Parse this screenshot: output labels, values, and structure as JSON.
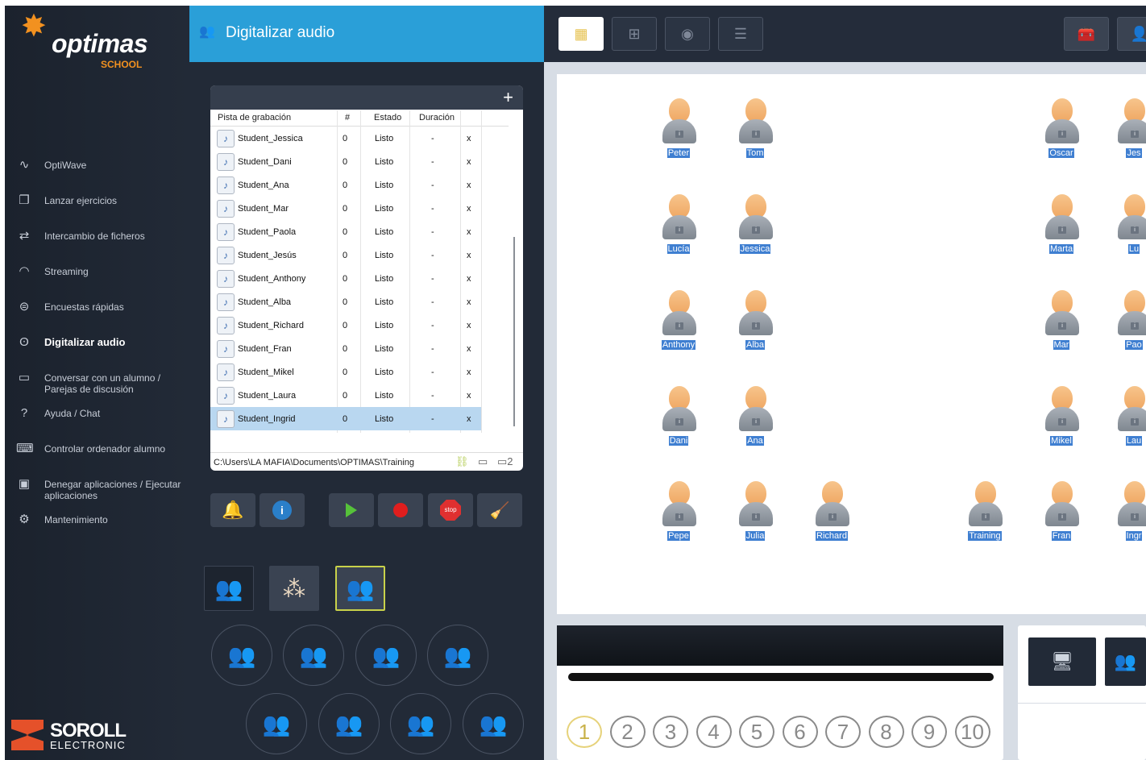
{
  "app": {
    "brand": "optimas",
    "brand_sub": "SCHOOL",
    "vendor": "SOROLL",
    "vendor_sub": "ELECTRONIC"
  },
  "menu": [
    {
      "label": "OptiWave",
      "icon": "waveform-icon"
    },
    {
      "label": "Lanzar ejercicios",
      "icon": "copy-icon"
    },
    {
      "label": "Intercambio de ficheros",
      "icon": "exchange-icon"
    },
    {
      "label": "Streaming",
      "icon": "wifi-icon"
    },
    {
      "label": "Encuestas rápidas",
      "icon": "survey-icon"
    },
    {
      "label": "Digitalizar audio",
      "icon": "people-audio-icon"
    },
    {
      "label": "Conversar con un alumno / Parejas de discusión",
      "icon": "chat-bubble-icon"
    },
    {
      "label": "Ayuda / Chat",
      "icon": "help-icon"
    },
    {
      "label": "Controlar ordenador alumno",
      "icon": "remote-control-icon"
    },
    {
      "label": "Denegar aplicaciones / Ejecutar aplicaciones",
      "icon": "apps-icon"
    },
    {
      "label": "Mantenimiento",
      "icon": "maintenance-icon"
    }
  ],
  "panel": {
    "title": "Digitalizar audio",
    "table": {
      "headers": [
        "Pista de grabación",
        "#",
        "Estado",
        "Duración"
      ],
      "rows": [
        {
          "name": "Student_Jessica",
          "count": "0",
          "status": "Listo",
          "duration": "-",
          "remove": "x"
        },
        {
          "name": "Student_Dani",
          "count": "0",
          "status": "Listo",
          "duration": "-",
          "remove": "x"
        },
        {
          "name": "Student_Ana",
          "count": "0",
          "status": "Listo",
          "duration": "-",
          "remove": "x"
        },
        {
          "name": "Student_Mar",
          "count": "0",
          "status": "Listo",
          "duration": "-",
          "remove": "x"
        },
        {
          "name": "Student_Paola",
          "count": "0",
          "status": "Listo",
          "duration": "-",
          "remove": "x"
        },
        {
          "name": "Student_Jesús",
          "count": "0",
          "status": "Listo",
          "duration": "-",
          "remove": "x"
        },
        {
          "name": "Student_Anthony",
          "count": "0",
          "status": "Listo",
          "duration": "-",
          "remove": "x"
        },
        {
          "name": "Student_Alba",
          "count": "0",
          "status": "Listo",
          "duration": "-",
          "remove": "x"
        },
        {
          "name": "Student_Richard",
          "count": "0",
          "status": "Listo",
          "duration": "-",
          "remove": "x"
        },
        {
          "name": "Student_Fran",
          "count": "0",
          "status": "Listo",
          "duration": "-",
          "remove": "x"
        },
        {
          "name": "Student_Mikel",
          "count": "0",
          "status": "Listo",
          "duration": "-",
          "remove": "x"
        },
        {
          "name": "Student_Laura",
          "count": "0",
          "status": "Listo",
          "duration": "-",
          "remove": "x"
        },
        {
          "name": "Student_Ingrid",
          "count": "0",
          "status": "Listo",
          "duration": "-",
          "remove": "x",
          "selected": true
        }
      ],
      "path": "C:\\Users\\LA MAFIA\\Documents\\OPTIMAS\\Training"
    },
    "controls": [
      {
        "name": "bell-button",
        "icon": "bell-icon"
      },
      {
        "name": "info-button",
        "icon": "info-icon"
      },
      {
        "name": "play-button",
        "icon": "play-icon"
      },
      {
        "name": "record-button",
        "icon": "record-icon"
      },
      {
        "name": "stop-button",
        "icon": "stop-icon",
        "label": "stop"
      },
      {
        "name": "clear-button",
        "icon": "broom-icon"
      }
    ]
  },
  "classroom": {
    "students": [
      {
        "name": "Peter"
      },
      {
        "name": "Tom"
      },
      {
        "name": "Oscar"
      },
      {
        "name": "Jes"
      },
      {
        "name": "Lucía"
      },
      {
        "name": "Jessica"
      },
      {
        "name": "Marta"
      },
      {
        "name": "Lu"
      },
      {
        "name": "Anthony"
      },
      {
        "name": "Alba"
      },
      {
        "name": "Mar"
      },
      {
        "name": "Pao"
      },
      {
        "name": "Dani"
      },
      {
        "name": "Ana"
      },
      {
        "name": "Mikel"
      },
      {
        "name": "Lau"
      },
      {
        "name": "Pepe"
      },
      {
        "name": "Julia"
      },
      {
        "name": "Richard"
      },
      {
        "name": "Training"
      },
      {
        "name": "Fran"
      },
      {
        "name": "Ingr"
      }
    ],
    "channels": [
      "1",
      "2",
      "3",
      "4",
      "5",
      "6",
      "7",
      "8",
      "9",
      "10"
    ],
    "selected_channel": "1"
  },
  "colors": {
    "accent": "#2a9fd8",
    "sidebar": "#1b222d",
    "panel": "#222a37",
    "label_bg": "#3f7fd1",
    "brand_orange": "#f29120"
  }
}
